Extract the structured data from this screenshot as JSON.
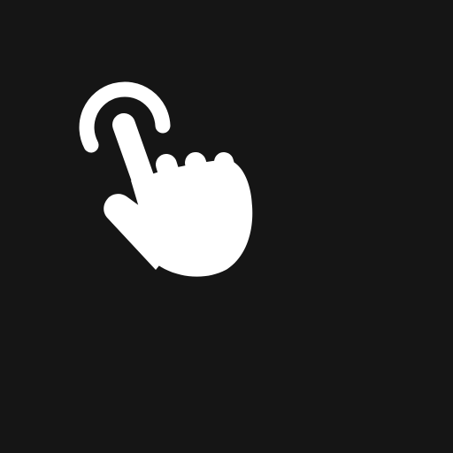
{
  "canvas": {
    "background": "#151515"
  },
  "icon": {
    "name": "tap-gesture-icon",
    "color": "#ffffff"
  }
}
